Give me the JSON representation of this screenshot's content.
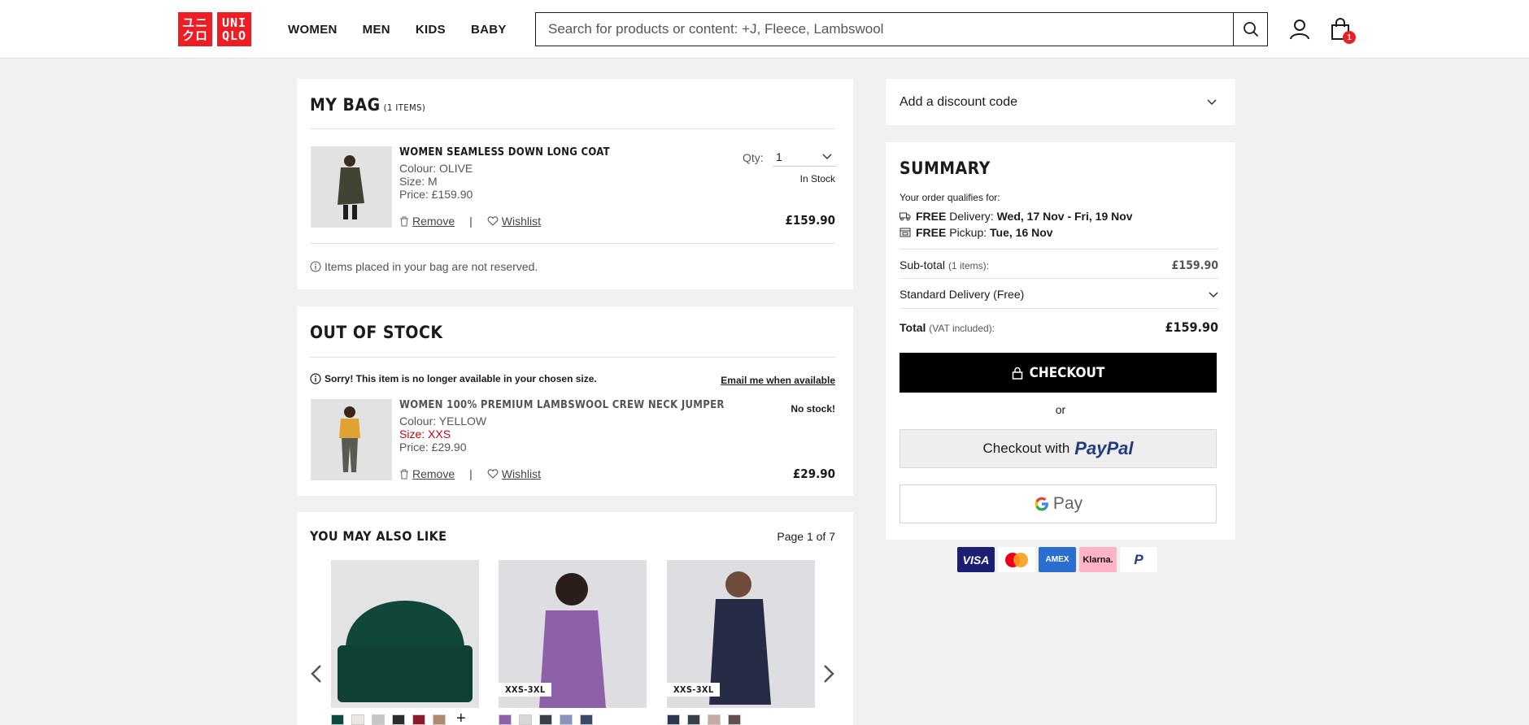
{
  "header": {
    "logo_top": "UNI",
    "logo_bottom": "QLO",
    "logo_kana_top": "ユニ",
    "logo_kana_bottom": "クロ",
    "nav": [
      "WOMEN",
      "MEN",
      "KIDS",
      "BABY"
    ],
    "search_placeholder": "Search for products or content: +J, Fleece, Lambswool",
    "cart_count": "1"
  },
  "bag": {
    "title": "MY BAG",
    "count": "(1 ITEMS)",
    "item": {
      "name": "WOMEN SEAMLESS DOWN LONG COAT",
      "colour": "Colour: OLIVE",
      "size": "Size: M",
      "price": "Price: £159.90",
      "qty_label": "Qty:",
      "qty_value": "1",
      "stock": "In Stock",
      "total": "£159.90",
      "remove": "Remove",
      "wishlist": "Wishlist"
    },
    "notice": "Items placed in your bag are not reserved."
  },
  "oos": {
    "title": "OUT OF STOCK",
    "warning": "Sorry! This item is no longer available in your chosen size.",
    "email_link": "Email me when available",
    "item": {
      "name": "WOMEN 100% PREMIUM LAMBSWOOL CREW NECK JUMPER",
      "colour": "Colour: YELLOW",
      "size": "Size: XXS",
      "price": "Price: £29.90",
      "stock": "No stock!",
      "total": "£29.90",
      "remove": "Remove",
      "wishlist": "Wishlist"
    }
  },
  "recs": {
    "title": "YOU MAY ALSO LIKE",
    "page": "Page 1 of 7",
    "size_tags": [
      "XXS-3XL",
      "XXS-3XL"
    ],
    "swatches": {
      "beanie": [
        "#0f4a3e",
        "#ece8e1",
        "#c5c5c5",
        "#2c2c2c",
        "#8d1a2a",
        "#b08a6e"
      ],
      "puffer": [
        "#8e60a8",
        "#d8d8d8",
        "#3b3f46",
        "#8a93bd",
        "#3a4a66"
      ],
      "coat": [
        "#2e3550",
        "#3a3f4d",
        "#c7aaa2",
        "#5e5050"
      ]
    },
    "more": "+"
  },
  "discount": {
    "label": "Add a discount code"
  },
  "summary": {
    "title": "SUMMARY",
    "qualifies": "Your order qualifies for:",
    "delivery_prefix": "FREE",
    "delivery_text": " Delivery: ",
    "delivery_date": "Wed, 17 Nov - Fri, 19 Nov",
    "pickup_prefix": "FREE",
    "pickup_text": " Pickup: ",
    "pickup_date": "Tue, 16 Nov",
    "subtotal_label": "Sub-total",
    "subtotal_items": "(1 items):",
    "subtotal_value": "£159.90",
    "shipping": "Standard Delivery (Free)",
    "total_label": "Total",
    "total_note": "(VAT included):",
    "total_value": "£159.90",
    "checkout": "CHECKOUT",
    "or": "or",
    "paypal_prefix": "Checkout with",
    "paypal_brand": "PayPal",
    "gpay_pay": "Pay",
    "cards": [
      "VISA",
      "",
      "AMEX",
      "Klarna.",
      "P"
    ]
  }
}
